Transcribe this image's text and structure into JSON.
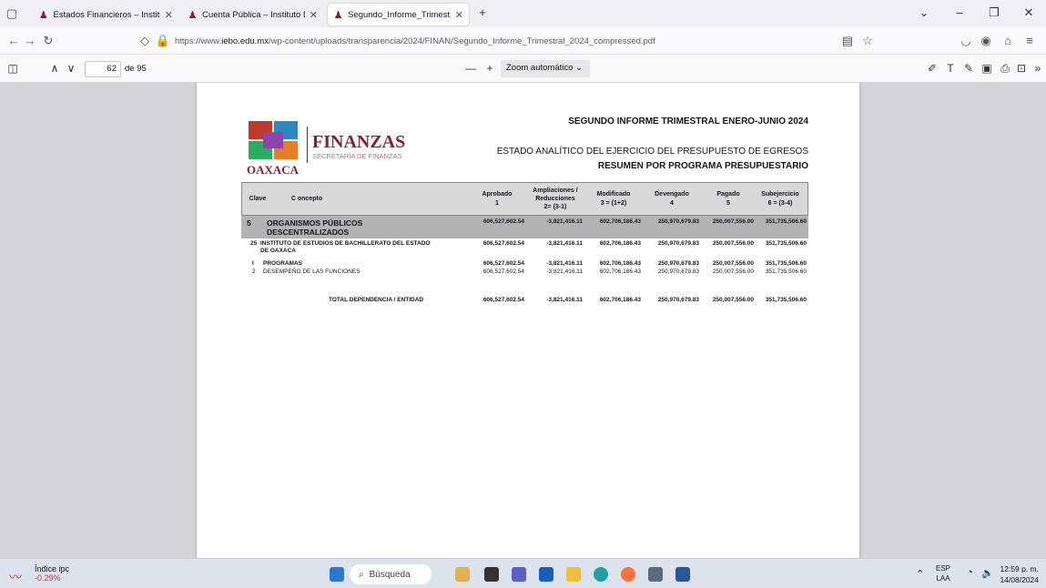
{
  "browser": {
    "tabs": [
      {
        "title": "Estados Financieros – Instituto D",
        "active": false
      },
      {
        "title": "Cuenta Pública – Instituto De Es",
        "active": false
      },
      {
        "title": "Segundo_Informe_Trimestral_2024",
        "active": true
      }
    ],
    "url_prefix": "https://www.",
    "url_domain": "iebo.edu.mx",
    "url_path": "/wp-content/uploads/transparencia/2024/FINAN/Segundo_Informe_Trimestral_2024_compressed.pdf"
  },
  "pdf_toolbar": {
    "page_current": "62",
    "page_total": "de 95",
    "zoom": "Zoom automático"
  },
  "document": {
    "logo": {
      "word": "FINANZAS",
      "sub": "SECRETARÍA DE FINANZAS",
      "state": "OAXACA"
    },
    "heading1": "SEGUNDO INFORME TRIMESTRAL ENERO-JUNIO 2024",
    "heading2": "ESTADO ANALÍTICO DEL EJERCICIO DEL PRESUPUESTO DE EGRESOS",
    "heading3": "RESUMEN POR PROGRAMA PRESUPUESTARIO",
    "columns": [
      {
        "l1": "Clave",
        "l2": ""
      },
      {
        "l1": "C oncepto",
        "l2": ""
      },
      {
        "l1": "Aprobado",
        "l2": "1"
      },
      {
        "l1": "Ampliaciones / Reducciones",
        "l2": "2= (3-1)"
      },
      {
        "l1": "Modificado",
        "l2": "3 = (1+2)"
      },
      {
        "l1": "Devengado",
        "l2": "4"
      },
      {
        "l1": "Pagado",
        "l2": "5"
      },
      {
        "l1": "Subejercicio",
        "l2": "6 = (3-4)"
      }
    ],
    "rows": [
      {
        "clave": "5",
        "concepto": "ORGANISMOS PÚBLICOS DESCENTRALIZADOS",
        "aprobado": "606,527,602.54",
        "ampliaciones": "-3,821,416.11",
        "modificado": "602,706,186.43",
        "devengado": "250,970,679.83",
        "pagado": "250,007,556.00",
        "subejercicio": "351,735,506.60"
      },
      {
        "clave": "25",
        "concepto": "INSTITUTO DE ESTUDIOS DE BACHILLERATO DEL ESTADO DE OAXACA",
        "aprobado": "606,527,602.54",
        "ampliaciones": "-3,821,416.11",
        "modificado": "602,706,186.43",
        "devengado": "250,970,679.83",
        "pagado": "250,007,556.00",
        "subejercicio": "351,735,506.60"
      },
      {
        "clave": "I",
        "concepto": "PROGRAMAS",
        "aprobado": "606,527,602.54",
        "ampliaciones": "-3,821,416.11",
        "modificado": "602,706,186.43",
        "devengado": "250,970,679.83",
        "pagado": "250,007,556.00",
        "subejercicio": "351,735,506.60"
      },
      {
        "clave": "2",
        "concepto": "DESEMPEÑO DE LAS FUNCIONES",
        "aprobado": "606,527,602.54",
        "ampliaciones": "-3,821,416.11",
        "modificado": "602,706,186.43",
        "devengado": "250,970,679.83",
        "pagado": "250,007,556.00",
        "subejercicio": "351,735,506.60"
      }
    ],
    "total": {
      "label": "TOTAL DEPENDENCIA / ENTIDAD",
      "aprobado": "606,527,602.54",
      "ampliaciones": "-3,821,416.11",
      "modificado": "602,706,186.43",
      "devengado": "250,970,679.83",
      "pagado": "250,007,556.00",
      "subejercicio": "351,735,506.60"
    }
  },
  "taskbar": {
    "weather_title": "Índice ipc",
    "weather_value": "-0.29%",
    "search": "Búsqueda",
    "lang1": "ESP",
    "lang2": "LAA",
    "time": "12:59 p. m.",
    "date": "14/08/2024"
  },
  "colors": {
    "accent": "#8a1d3c",
    "group_row": "#b3b3b3"
  }
}
